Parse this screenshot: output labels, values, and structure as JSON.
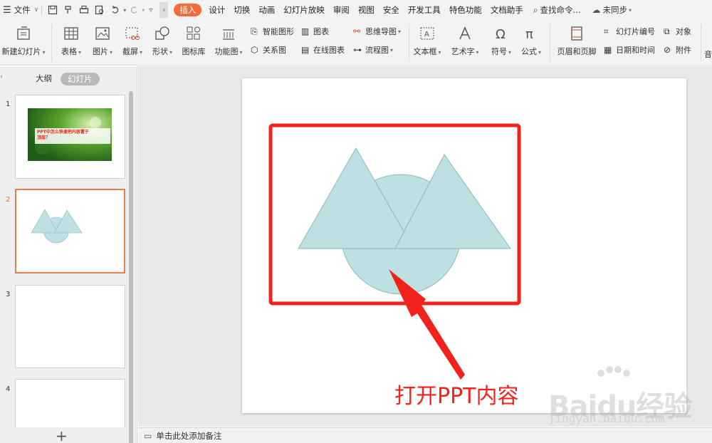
{
  "menubar": {
    "file_label": "文件",
    "tabs": [
      "插入",
      "设计",
      "切换",
      "动画",
      "幻灯片放映",
      "审阅",
      "视图",
      "安全",
      "开发工具",
      "特色功能",
      "文档助手"
    ],
    "active_tab": "插入",
    "search_label": "查找命令...",
    "sync_label": "未同步"
  },
  "ribbon": {
    "new_slide": "新建幻灯片",
    "table": "表格",
    "picture": "图片",
    "screenshot": "截屏",
    "shape": "形状",
    "icon_lib": "图标库",
    "function_chart": "功能图",
    "smart_shape": "智能图形",
    "chart": "图表",
    "relation_chart": "关系图",
    "online_chart": "在线图表",
    "mind_map": "思维导图",
    "flow_chart": "流程图",
    "textbox": "文本框",
    "wordart": "艺术字",
    "symbol": "符号",
    "formula": "公式",
    "header_footer": "页眉和页脚",
    "slide_number": "幻灯片编号",
    "datetime": "日期和时间",
    "object": "对象",
    "attachment": "附件",
    "more": "音"
  },
  "left_panel": {
    "outline_tab": "大纲",
    "slides_tab": "幻灯片",
    "active_tab": "幻灯片",
    "slides": [
      {
        "number": "1",
        "title_text": "PPT中怎么快速把内容置于顶层？"
      },
      {
        "number": "2"
      },
      {
        "number": "3"
      },
      {
        "number": "4"
      }
    ],
    "selected_slide": "2"
  },
  "notes": {
    "placeholder": "单击此处添加备注"
  },
  "annotation": {
    "text": "打开PPT内容",
    "color": "#f0231c"
  },
  "shapes": {
    "fill": "#bde0e2",
    "stroke": "#8fb9bc"
  },
  "watermark": {
    "logo": "Baidu经验",
    "url": "jingyan.baidu.com"
  },
  "colors": {
    "accent": "#f26b3a",
    "highlight_box": "#f0231c"
  }
}
